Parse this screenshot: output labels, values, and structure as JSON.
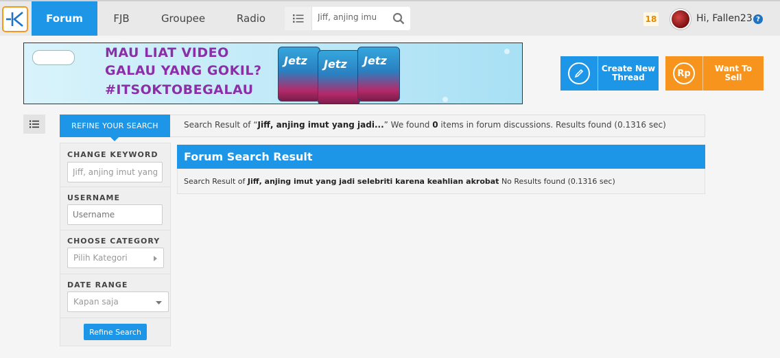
{
  "nav": {
    "tabs": [
      {
        "label": "Forum",
        "active": true
      },
      {
        "label": "FJB"
      },
      {
        "label": "Groupee"
      },
      {
        "label": "Radio"
      }
    ],
    "search_value": "Jiff, anjing imu",
    "notifications": "18",
    "greeting": "Hi, Fallen23"
  },
  "banner": {
    "line1": "MAU LIAT VIDEO",
    "line2": "GALAU YANG GOKIL?",
    "line3": "#ITSOKTOBEGALAU",
    "product": "Jetz"
  },
  "actions": {
    "create_thread": "Create New Thread",
    "want_to_sell": "Want To Sell",
    "sell_icon_text": "Rp"
  },
  "refine": {
    "tab_label": "REFINE YOUR SEARCH",
    "summary_prefix": "Search Result of “",
    "summary_query": "Jiff, anjing imut yang jadi...",
    "summary_mid": "” We found ",
    "summary_count": "0",
    "summary_suffix": " items in forum discussions. Results found (0.1316 sec)",
    "keyword_label": "CHANGE KEYWORD",
    "keyword_value": "Jiff, anjing imut yang jadi",
    "username_label": "USERNAME",
    "username_placeholder": "Username",
    "category_label": "CHOOSE CATEGORY",
    "category_value": "Pilih Kategori",
    "date_label": "DATE RANGE",
    "date_value": "Kapan saja",
    "button_label": "Refine Search"
  },
  "forum_result": {
    "title": "Forum Search Result",
    "prefix": "Search Result of ",
    "query": "Jiff, anjing imut yang jadi selebriti karena keahlian akrobat",
    "suffix": " No Results found (0.1316 sec)"
  },
  "colors": {
    "primary": "#1e96e8",
    "accent": "#f7941d"
  }
}
